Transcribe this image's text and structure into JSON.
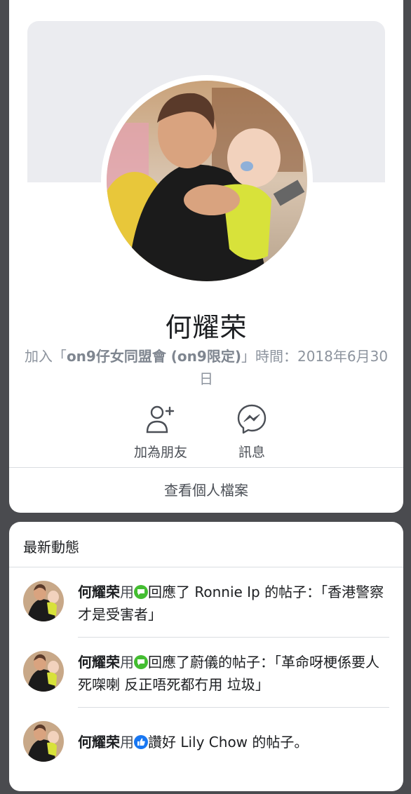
{
  "profile": {
    "name": "何耀荣",
    "joined_prefix": "加入「",
    "group_name": "on9仔女同盟會 (on9限定)",
    "joined_suffix": "」時間：2018年6月30日"
  },
  "actions": {
    "add_friend": "加為朋友",
    "message": "訊息"
  },
  "view_profile": "查看個人檔案",
  "feed": {
    "title": "最新動態",
    "items": [
      {
        "actor": "何耀荣",
        "via": "用",
        "action": "回應了",
        "target": " Ronnie Ip 的帖子：「香港警察才是受害者」",
        "icon": "comment-badge-icon"
      },
      {
        "actor": "何耀荣",
        "via": "用",
        "action": "回應了",
        "target": "蔚儀的帖子：「革命呀梗係要人死㗎喇 反正唔死都冇用 垃圾」",
        "icon": "comment-badge-icon"
      },
      {
        "actor": "何耀荣",
        "via": "用",
        "action": "讚好",
        "target": " Lily Chow 的帖子。",
        "icon": "like-badge-icon"
      }
    ]
  },
  "colors": {
    "background": "#4a4b4f",
    "comment_green": "#44bd32",
    "like_blue": "#1877f2",
    "cover_gray": "#ebecf0"
  }
}
